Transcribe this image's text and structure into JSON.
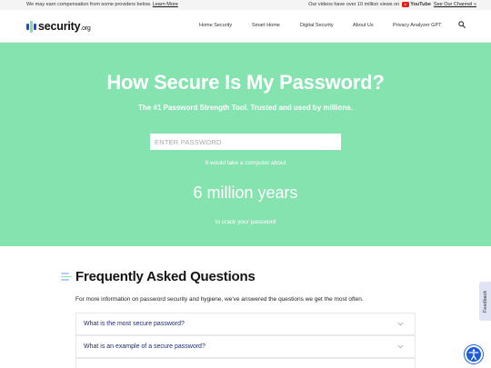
{
  "topbar": {
    "disclaimer": "We may earn compensation from some providers below.",
    "learn_more": "Learn More",
    "videos_text": "Our videos have over 10 million views on",
    "youtube": "YouTube",
    "channel_link": "See Our Channel »"
  },
  "logo": {
    "name": "security",
    "tld": ".org"
  },
  "nav": {
    "items": [
      "Home Security",
      "Smart Home",
      "Digital Security",
      "About Us",
      "Privacy Analyzer GPT"
    ],
    "search_icon": "search-icon"
  },
  "hero": {
    "title": "How Secure Is My Password?",
    "subtitle": "The #1 Password Strength Tool. Trusted and used by millions.",
    "input_placeholder": "ENTER PASSWORD",
    "input_value": "",
    "take_text": "It would take a computer about",
    "result": "6 million years",
    "crack_text": "to crack your password"
  },
  "faq": {
    "title": "Frequently Asked Questions",
    "intro": "For more information on password security and hygiene, we've answered the questions we get the most often.",
    "items": [
      "What is the most secure password?",
      "What is an example of a secure password?"
    ]
  },
  "widgets": {
    "feedback": "Feedback",
    "accessibility_icon": "accessibility-icon"
  },
  "colors": {
    "hero_bg": "#84e3ae",
    "brand_blue": "#1b4de0",
    "question_text": "#1e2a6e",
    "youtube_red": "#e62117"
  }
}
